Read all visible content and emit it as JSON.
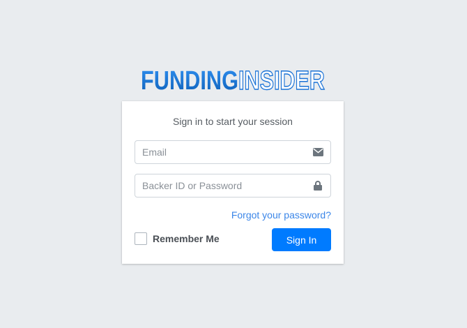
{
  "brand": {
    "part1": "FUNDING",
    "part2": "INSIDER"
  },
  "login": {
    "message": "Sign in to start your session",
    "email_placeholder": "Email",
    "password_placeholder": "Backer ID or Password",
    "forgot_link": "Forgot your password?",
    "remember_label": "Remember Me",
    "submit_label": "Sign In",
    "email_icon": "envelope-icon",
    "password_icon": "lock-icon"
  },
  "colors": {
    "background": "#e9ecef",
    "brand_blue": "#0a74d8",
    "primary_button": "#007bff",
    "link": "#3b86e8"
  }
}
